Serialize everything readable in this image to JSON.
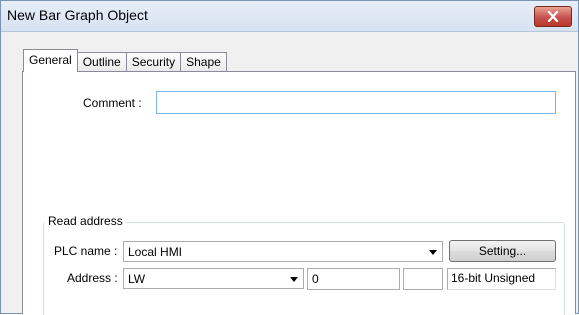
{
  "window": {
    "title": "New Bar Graph Object"
  },
  "tabs": [
    {
      "label": "General",
      "active": true
    },
    {
      "label": "Outline",
      "active": false
    },
    {
      "label": "Security",
      "active": false
    },
    {
      "label": "Shape",
      "active": false
    }
  ],
  "general": {
    "comment_label": "Comment :",
    "comment_value": ""
  },
  "read_address": {
    "group_label": "Read address",
    "plc_name_label": "PLC name :",
    "plc_name_value": "Local HMI",
    "setting_button": "Setting...",
    "address_label": "Address :",
    "device_type_value": "LW",
    "address_value": "0",
    "index_value": "",
    "data_format": "16-bit Unsigned"
  },
  "icons": {
    "close": "close-icon",
    "dropdown": "chevron-down-icon"
  },
  "colors": {
    "close_button": "#c75050",
    "focus_border": "#7eb4ea"
  }
}
